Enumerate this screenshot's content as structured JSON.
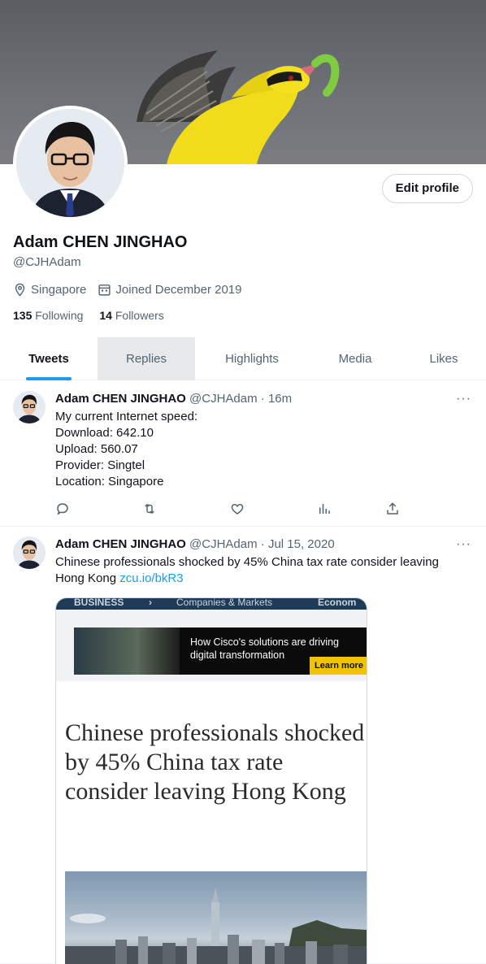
{
  "profile": {
    "name": "Adam CHEN JINGHAO",
    "handle": "@CJHAdam",
    "location": "Singapore",
    "joined": "Joined December 2019",
    "following_count": "135",
    "following_label": "Following",
    "followers_count": "14",
    "followers_label": "Followers",
    "edit_label": "Edit profile"
  },
  "tabs": [
    {
      "label": "Tweets",
      "active": true
    },
    {
      "label": "Replies",
      "hovered": true
    },
    {
      "label": "Highlights"
    },
    {
      "label": "Media"
    },
    {
      "label": "Likes"
    }
  ],
  "tweets": [
    {
      "name": "Adam CHEN JINGHAO",
      "meta": "@CJHAdam · 16m",
      "lines": [
        "My current Internet speed:",
        "Download: 642.10",
        "Upload: 560.07",
        "Provider: Singtel",
        "Location: Singapore"
      ],
      "more": "···"
    },
    {
      "name": "Adam CHEN JINGHAO",
      "meta": "@CJHAdam · Jul 15, 2020",
      "text": "Chinese professionals shocked by 45% China tax rate consider leaving Hong Kong",
      "link": "zcu.io/bkR3",
      "more": "···",
      "card": {
        "nav1": "BUSINESS",
        "nav_arrow": "›",
        "nav2": "Companies & Markets",
        "nav3": "Econom",
        "ad_text": "How Cisco's solutions are driving digital transformation",
        "ad_cta": "Learn more",
        "headline": "Chinese professionals shocked by 45% China tax rate consider leaving Hong Kong"
      }
    }
  ],
  "colors": {
    "accent": "#1d9bf0",
    "text": "#0f1419",
    "muted": "#536471",
    "border": "#cfd9de"
  }
}
